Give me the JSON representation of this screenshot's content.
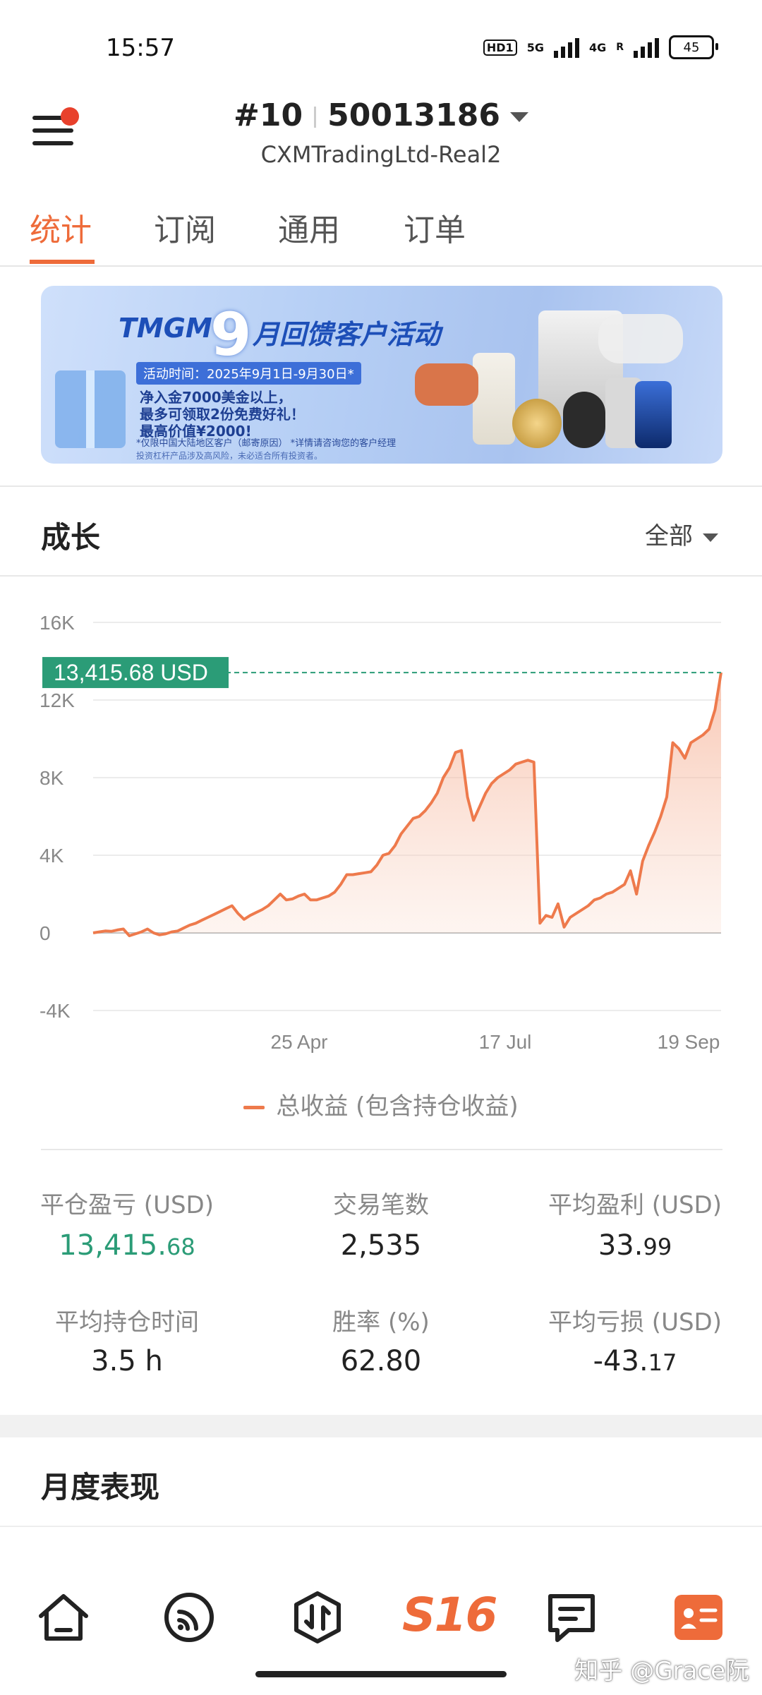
{
  "status_bar": {
    "time": "15:57",
    "hd_label": "HD1",
    "net1_label": "5G",
    "net2_label": "4G",
    "roam_label": "R",
    "battery": "45"
  },
  "header": {
    "account_index": "#10",
    "account_number": "50013186",
    "server": "CXMTradingLtd-Real2",
    "menu_icon": "hamburger-icon",
    "has_notification_dot": true
  },
  "tabs": [
    {
      "label": "统计",
      "active": true
    },
    {
      "label": "订阅",
      "active": false
    },
    {
      "label": "通用",
      "active": false
    },
    {
      "label": "订单",
      "active": false
    }
  ],
  "banner": {
    "brand": "TMGM",
    "nine": "9",
    "title": "月回馈客户活动",
    "date": "活动时间：2025年9月1日-9月30日*",
    "line1": "净入金7000美金以上，",
    "line2": "最多可领取2份免费好礼！",
    "line3": "最高价值¥2000!",
    "note": "*仅限中国大陆地区客户（邮寄原因） *详情请咨询您的客户经理",
    "footer": "投资杠杆产品涉及高风险，未必适合所有投资者。"
  },
  "growth": {
    "title": "成长",
    "filter_label": "全部"
  },
  "chart_data": {
    "type": "area",
    "y_ticks": [
      "16K",
      "12K",
      "8K",
      "4K",
      "0",
      "-4K"
    ],
    "ylim": [
      -4000,
      16000
    ],
    "x_ticks": [
      "25 Apr",
      "17 Jul",
      "19 Sep"
    ],
    "current_value_label": "13,415.68 USD",
    "current_value": 13415.68,
    "series": [
      {
        "name": "总收益 (包含持仓收益)",
        "color": "#ee7a4c",
        "values": [
          0,
          50,
          100,
          80,
          150,
          200,
          -150,
          -50,
          50,
          200,
          0,
          -100,
          -50,
          50,
          100,
          250,
          400,
          500,
          650,
          800,
          950,
          1100,
          1250,
          1400,
          1000,
          700,
          900,
          1050,
          1200,
          1400,
          1700,
          2000,
          1700,
          1750,
          1900,
          2000,
          1700,
          1700,
          1800,
          1900,
          2100,
          2500,
          3000,
          3000,
          3050,
          3100,
          3150,
          3500,
          4000,
          4100,
          4500,
          5100,
          5500,
          5900,
          6000,
          6300,
          6700,
          7200,
          8000,
          8500,
          9300,
          9400,
          7000,
          5800,
          6500,
          7200,
          7700,
          8000,
          8200,
          8400,
          8700,
          8800,
          8900,
          8800,
          500,
          900,
          800,
          1500,
          300,
          800,
          1000,
          1200,
          1400,
          1700,
          1800,
          2000,
          2100,
          2300,
          2500,
          3200,
          2000,
          3700,
          4500,
          5200,
          6000,
          7000,
          9800,
          9500,
          9000,
          9800,
          10000,
          10200,
          10500,
          11500,
          13415.68
        ]
      }
    ],
    "legend": "总收益 (包含持仓收益)"
  },
  "stats": [
    {
      "label": "平仓盈亏 (USD)",
      "int": "13,415.",
      "dec": "68",
      "color": "green"
    },
    {
      "label": "交易笔数",
      "int": "2,535",
      "dec": "",
      "color": "normal"
    },
    {
      "label": "平均盈利 (USD)",
      "int": "33.",
      "dec": "99",
      "color": "normal"
    },
    {
      "label": "平均持仓时间",
      "int": "3.5 h",
      "dec": "",
      "color": "normal"
    },
    {
      "label": "胜率 (%)",
      "int": "62.80",
      "dec": "",
      "color": "normal"
    },
    {
      "label": "平均亏损 (USD)",
      "int": "-43.",
      "dec": "17",
      "color": "normal"
    }
  ],
  "monthly": {
    "title": "月度表现"
  },
  "bottom_nav": {
    "items": [
      "home-icon",
      "feed-icon",
      "trade-icon",
      "brand-logo",
      "chat-icon",
      "profile-card-icon"
    ],
    "brand_text": "S16",
    "active_color": "#ee6b3a"
  },
  "watermark": "知乎 @Grace阮"
}
